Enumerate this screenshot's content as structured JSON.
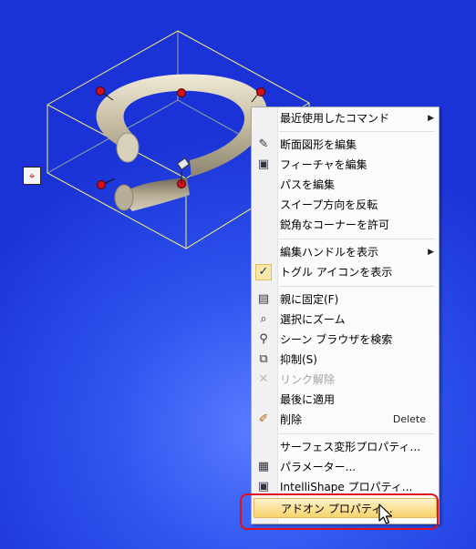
{
  "colors": {
    "background": "#2f55f0",
    "highlight": "#f8d46d",
    "callout": "#e00f1b",
    "handle": "#d0101a",
    "bounding_box": "#f2f27a"
  },
  "menu": {
    "items": [
      {
        "label": "最近使用したコマンド",
        "icon": "",
        "submenu": true
      },
      {
        "label": "断面図形を編集",
        "icon": "edit-section-icon"
      },
      {
        "label": "フィーチャを編集",
        "icon": "edit-feature-icon"
      },
      {
        "label": "パスを編集",
        "icon": ""
      },
      {
        "label": "スイープ方向を反転",
        "icon": ""
      },
      {
        "label": "鋭角なコーナーを許可",
        "icon": ""
      },
      {
        "label": "編集ハンドルを表示",
        "icon": "",
        "submenu": true
      },
      {
        "label": "トグル アイコンを表示",
        "icon": "checkmark-icon",
        "checked": true
      },
      {
        "label": "親に固定(F)",
        "icon": "anchor-to-parent-icon"
      },
      {
        "label": "選択にズーム",
        "icon": "zoom-icon"
      },
      {
        "label": "シーン ブラウザを検索",
        "icon": "scene-browser-icon"
      },
      {
        "label": "抑制(S)",
        "icon": "suppress-icon"
      },
      {
        "label": "リンク解除",
        "icon": "unlink-icon",
        "disabled": true
      },
      {
        "label": "最後に適用",
        "icon": ""
      },
      {
        "label": "削除",
        "icon": "delete-icon",
        "shortcut": "Delete"
      },
      {
        "label": "サーフェス変形プロパティ...",
        "icon": ""
      },
      {
        "label": "パラメーター...",
        "icon": "parameters-icon"
      },
      {
        "label": "IntelliShape プロパティ...",
        "icon": "intellishape-properties-icon"
      },
      {
        "label": "アドオン プロパティ...",
        "icon": "",
        "highlighted": true
      }
    ]
  }
}
